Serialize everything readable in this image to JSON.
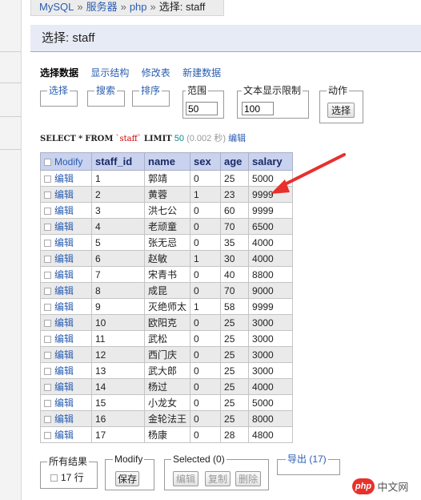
{
  "breadcrumb": {
    "parts": [
      "MySQL",
      "服务器",
      "php",
      "选择: staff"
    ],
    "separator": "»"
  },
  "page_title": "选择: staff",
  "tabs": [
    "选择数据",
    "显示结构",
    "修改表",
    "新建数据"
  ],
  "filters": {
    "select_legend": "选择",
    "search_legend": "搜索",
    "sort_legend": "排序",
    "range_legend": "范围",
    "range_value": "50",
    "text_limit_legend": "文本显示限制",
    "text_limit_value": "100",
    "action_legend": "动作",
    "select_button": "选择"
  },
  "sql": {
    "select_kw": "SELECT",
    "star": "*",
    "from_kw": "FROM",
    "table": "`staff`",
    "limit_kw": "LIMIT",
    "limit_value": "50",
    "time": "(0.002 秒)",
    "edit_link": "编辑"
  },
  "table": {
    "modify_header": "Modify",
    "columns": [
      "staff_id",
      "name",
      "sex",
      "age",
      "salary"
    ],
    "edit_label": "编辑",
    "rows": [
      [
        "1",
        "郭靖",
        "0",
        "25",
        "5000"
      ],
      [
        "2",
        "黄蓉",
        "1",
        "23",
        "9999"
      ],
      [
        "3",
        "洪七公",
        "0",
        "60",
        "9999"
      ],
      [
        "4",
        "老顽童",
        "0",
        "70",
        "6500"
      ],
      [
        "5",
        "张无忌",
        "0",
        "35",
        "4000"
      ],
      [
        "6",
        "赵敏",
        "1",
        "30",
        "4000"
      ],
      [
        "7",
        "宋青书",
        "0",
        "40",
        "8800"
      ],
      [
        "8",
        "成昆",
        "0",
        "70",
        "9000"
      ],
      [
        "9",
        "灭绝师太",
        "1",
        "58",
        "9999"
      ],
      [
        "10",
        "欧阳克",
        "0",
        "25",
        "3000"
      ],
      [
        "11",
        "武松",
        "0",
        "25",
        "3000"
      ],
      [
        "12",
        "西门庆",
        "0",
        "25",
        "3000"
      ],
      [
        "13",
        "武大郎",
        "0",
        "25",
        "3000"
      ],
      [
        "14",
        "杨过",
        "0",
        "25",
        "4000"
      ],
      [
        "15",
        "小龙女",
        "0",
        "25",
        "5000"
      ],
      [
        "16",
        "金轮法王",
        "0",
        "25",
        "8000"
      ],
      [
        "17",
        "杨康",
        "0",
        "28",
        "4800"
      ]
    ]
  },
  "footer": {
    "all_results_legend": "所有结果",
    "row_count": "17 行",
    "modify_legend": "Modify",
    "save_button": "保存",
    "selected_legend": "Selected (0)",
    "edit_button": "编辑",
    "copy_button": "复制",
    "delete_button": "删除",
    "export_link": "导出 (17)"
  },
  "watermark": {
    "logo": "php",
    "text": "中文网"
  },
  "colors": {
    "link": "#2a5db0",
    "header_bg": "#c9d2ee",
    "arrow": "#e8302c"
  }
}
